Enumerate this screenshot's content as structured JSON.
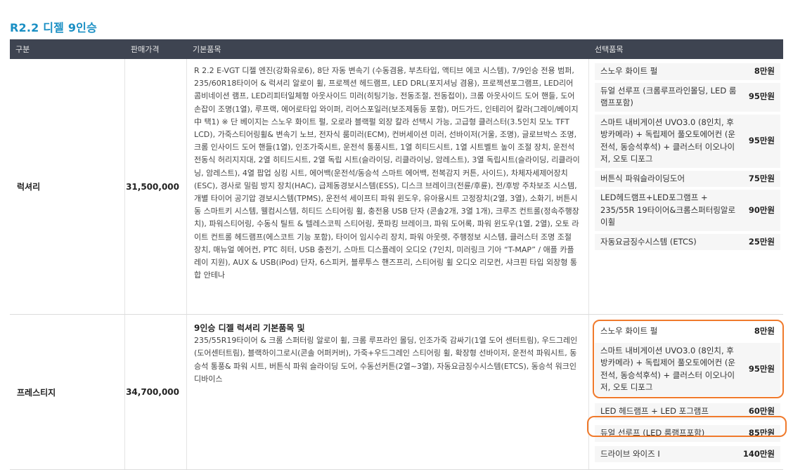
{
  "section_title": "R2.2 디젤 9인승",
  "columns": [
    "구분",
    "판매가격",
    "기본품목",
    "선택품목"
  ],
  "rows": [
    {
      "grade": "럭셔리",
      "price": "31,500,000",
      "basic_heading": "",
      "basic_text": "R 2.2 E-VGT 디젤 엔진(강화유로6), 8단 자동 변속기 (수동겸용, 부츠타입, 액티브 에코 시스템), 7/9인승 전용 범퍼, 235/60R18타이어 & 럭셔리 알로이 휠, 프로젝션 헤드램프, LED DRL(포지셔닝 겸용), 프로젝션포그램프, LED리어콤비네이션 램프, LED리피터일체형 아웃사이드 미러(히팅기능, 전동조절, 전동접이), 크롬 아웃사이드 도어 핸들, 도어손잡이 조명(1열), 루프랙, 에어로타입 와이퍼, 리어스포일러(보조제동등 포함), 머드가드, 인테리어 칼라(그레이/베이지 中 택1) ※ 단 베이지는 스노우 화이트 펄, 오로라 블랙펄 외장 칼라 선택시 가능, 고급형 클러스터(3.5인치 모노 TFT LCD), 가죽스티어링휠& 변속기 노브, 전자식 룸미러(ECM), 컨버세이션 미러, 선바이저(거울, 조명), 글로브박스 조명, 크롬 인사이드 도어 핸들(1열), 인조가죽시트, 운전석 통풍시트, 1열 히티드시트, 1열 시트벨트 높이 조절 장치, 운전석 전동식 허리지지대, 2열 히티드시트, 2열 독립 시트(슬라이딩, 리클라이닝, 암레스트), 3열 독립시트(슬라이딩, 리클라이닝, 암레스트), 4열 팝업 싱킹 시트, 에어백(운전석/동승석 스마트 에어백, 전복감지 커튼, 사이드), 차체자세제어장치(ESC), 경사로 밀림 방지 장치(HAC), 급제동경보시스템(ESS), 디스크 브레이크(전륜/후륜), 전/후방 주차보조 시스템, 개별 타이어 공기압 경보시스템(TPMS), 운전석 세이프티 파워 윈도우, 유아용시트 고정장치(2열, 3열), 소화기, 버튼시동 스마트키 시스템, 웰컴시스템, 히티드 스티어링 휠, 충전용 USB 단자 (콘솔2개, 3열 1개), 크루즈 컨트롤(정속주행장치), 파워스티어링, 수동식 틸트 & 텔레스코픽 스티어링, 풋파킹 브레이크, 파워 도어록, 파워 윈도우(1열, 2열), 오토 라이트 컨트롤 헤드램프(에스코트 기능 포함), 타이어 임시수리 장치, 파워 아웃렛, 주행정보 시스템, 클러스터 조명 조절 장치, 매뉴얼 에어컨, PTC 히터, USB 충전기, 스마트 디스플레이 오디오 (7인치, 미러링크 기아 “T-MAP” / 애플 카플레이 지원), AUX & USB(iPod) 단자, 6스피커, 블루투스 핸즈프리, 스티어링 휠 오디오 리모컨, 샤크핀 타입 외장형 통합 안테나",
      "options": [
        {
          "name": "스노우 화이트 펄",
          "price": "8만원"
        },
        {
          "name": "듀얼 선루프 (크롬루프라인몰딩, LED 룸램프포함)",
          "price": "95만원"
        },
        {
          "name": "스마트 내비게이션 UVO3.0 (8인치, 후방카메라) + 독립제어 풀오토에어컨 (운전석, 동승석후석) + 클러스터 이오나이저, 오토 디포그",
          "price": "95만원"
        },
        {
          "name": "버튼식 파워슬라이딩도어",
          "price": "75만원"
        },
        {
          "name": "LED헤드램프+LED포그램프 + 235/55R 19타이어&크롬스퍼터링알로이휠",
          "price": "90만원"
        },
        {
          "name": "자동요금징수시스템 (ETCS)",
          "price": "25만원"
        }
      ]
    },
    {
      "grade": "프레스티지",
      "price": "34,700,000",
      "basic_heading": "9인승 디젤 럭셔리 기본품목 및",
      "basic_text": "235/55R19타이어 & 크롬 스퍼터링 알로이 휠, 크롬 루프라인 몰딩, 인조가죽 감싸기(1열 도어 센터트림), 우드그레인 (도어센터트림), 블랙하이그로시(콘솔 어퍼커버), 가죽+우드그레인 스티어링 휠, 확장형 선바이저, 운전석 파워시트, 동승석 통풍& 파워 시트, 버튼식 파워 슬라이딩 도어, 수동선커튼(2열~3열), 자동요금징수시스템(ETCS), 동승석 워크인 디바이스",
      "options": [
        {
          "name": "스노우 화이트 펄",
          "price": "8만원"
        },
        {
          "name": "스마트 내비게이션 UVO3.0 (8인치, 후방카메라) + 독립제어 풀오토에어컨 (운전석, 동승석후석) + 클러스터 이오나이저, 오토 디포그",
          "price": "95만원"
        },
        {
          "name": "LED 헤드램프 + LED 포그램프",
          "price": "60만원"
        },
        {
          "name": "듀얼 선루프 (LED 룸램프포함)",
          "price": "85만원"
        },
        {
          "name": "드라이브 와이즈 I",
          "price": "140만원"
        }
      ]
    }
  ],
  "colors": {
    "title": "#1a8fc4",
    "header_bg": "#3e4451",
    "highlight": "#f07a2c"
  }
}
